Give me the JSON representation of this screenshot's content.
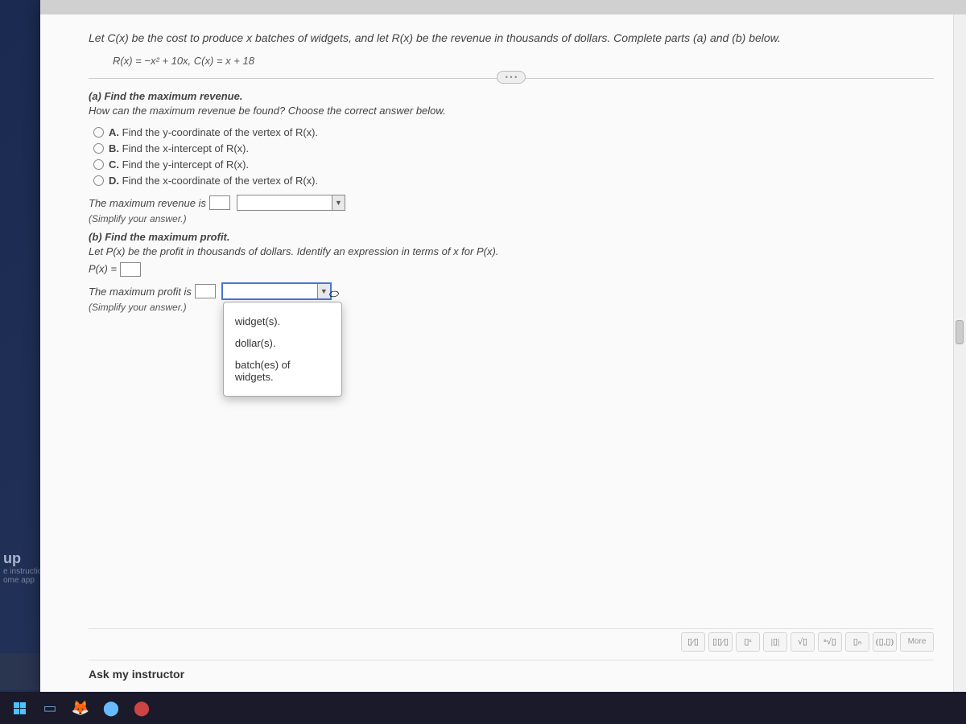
{
  "problem": {
    "intro": "Let C(x) be the cost to produce x batches of widgets, and let R(x) be the revenue in thousands of dollars. Complete parts (a) and (b) below.",
    "formula": "R(x) = −x² + 10x,  C(x) = x + 18"
  },
  "part_a": {
    "label": "(a) Find the maximum revenue.",
    "prompt": "How can the maximum revenue be found? Choose the correct answer below.",
    "choices": {
      "a": "Find the y-coordinate of the vertex of R(x).",
      "b": "Find the x-intercept of R(x).",
      "c": "Find the y-intercept of R(x).",
      "d": "Find the x-coordinate of the vertex of R(x)."
    },
    "answer_line": "The maximum revenue is",
    "help": "(Simplify your answer.)"
  },
  "part_b": {
    "label": "(b) Find the maximum profit.",
    "prompt": "Let P(x) be the profit in thousands of dollars. Identify an expression in terms of x for P(x).",
    "px": "P(x) =",
    "answer_line": "The maximum profit is",
    "help": "(Simplify your answer.)"
  },
  "dropdown": {
    "opt1": "widget(s).",
    "opt2": "dollar(s).",
    "opt3": "batch(es) of widgets."
  },
  "palette": {
    "b1": "▯⁄▯",
    "b2": "▯▯⁄▯",
    "b3": "▯ˣ",
    "b4": "|▯|",
    "b5": "√▯",
    "b6": "ⁿ√▯",
    "b7": "▯ₙ",
    "b8": "(▯,▯)",
    "more": "More"
  },
  "ask": "Ask my instructor",
  "left": {
    "up": "up",
    "sub1": "e instructions at th",
    "sub2": "ome app"
  }
}
